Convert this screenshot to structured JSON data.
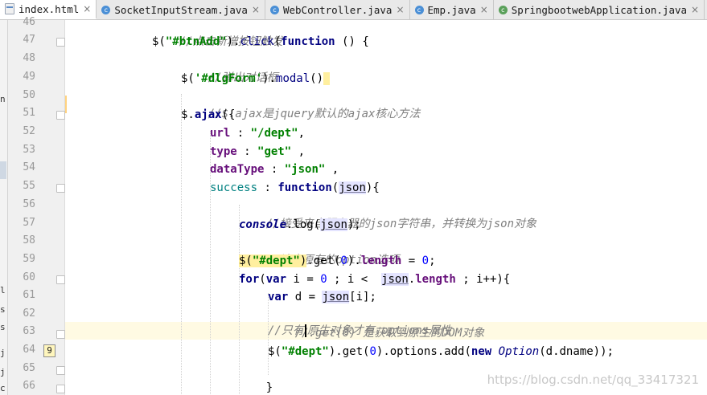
{
  "tabs": [
    {
      "label": "index.html",
      "icon": "html-file-icon",
      "active": true
    },
    {
      "label": "SocketInputStream.java",
      "icon": "class-icon",
      "active": false
    },
    {
      "label": "WebController.java",
      "icon": "class-icon",
      "active": false
    },
    {
      "label": "Emp.java",
      "icon": "class-icon",
      "active": false
    },
    {
      "label": "SpringbootwebApplication.java",
      "icon": "spring-class-icon",
      "active": false
    }
  ],
  "close_glyph": "×",
  "gutter": {
    "line_numbers": [
      "46",
      "47",
      "48",
      "49",
      "50",
      "51",
      "52",
      "53",
      "54",
      "55",
      "56",
      "57",
      "58",
      "59",
      "60",
      "61",
      "62",
      "63",
      "64",
      "65",
      "66"
    ],
    "badge_value": "9"
  },
  "left_strip": [
    "n",
    "l",
    "s",
    "s",
    "j",
    "j",
    "c"
  ],
  "code_lines": {
    "l46": "//点击新增按钮触发",
    "l47_a": "$(",
    "l47_b": "\"#btnAdd\"",
    "l47_c": ").",
    "l47_d": "click",
    "l47_e": "(",
    "l47_f": "function",
    "l47_g": " () {",
    "l48": "//弹出对话框",
    "l49_a": "$(",
    "l49_b": "'#dlgForm'",
    "l49_c": ").",
    "l49_d": "modal",
    "l49_e": "()",
    "l50": "//$.ajax是jquery默认的ajax核心方法",
    "l51_a": "$.",
    "l51_b": "ajax",
    "l51_c": "({",
    "l52_a": "url",
    "l52_b": " : ",
    "l52_c": "\"/dept\"",
    "l52_d": ",",
    "l53_a": "type",
    "l53_b": " : ",
    "l53_c": "\"get\"",
    "l53_d": " ,",
    "l54_a": "dataType",
    "l54_b": " : ",
    "l54_c": "\"json\"",
    "l54_d": " ,",
    "l55_a": "success",
    "l55_b": " : ",
    "l55_c": "function",
    "l55_d": "(",
    "l55_e": "json",
    "l55_f": "){",
    "l56": "//接受来自服务器的json字符串，并转换为json对象",
    "l57_a": "console",
    "l57_b": ".log(",
    "l57_c": "json",
    "l57_d": ");",
    "l58": "//清空原有的option选项",
    "l59_a": "$(",
    "l59_b": "\"#dept\"",
    "l59_c": ")",
    "l59_d": ".get(",
    "l59_e": "0",
    "l59_f": ").",
    "l59_g": "length",
    "l59_h": " = ",
    "l59_i": "0",
    "l59_j": ";",
    "l60_a": "for",
    "l60_b": "(",
    "l60_c": "var",
    "l60_d": " i = ",
    "l60_e": "0",
    "l60_f": " ; i <  ",
    "l60_g": "json",
    "l60_h": ".",
    "l60_i": "length",
    "l60_j": " ; i++){",
    "l61_a": "var",
    "l61_b": " d = ",
    "l61_c": "json",
    "l61_d": "[i];",
    "l62": "//.get(0) 是获取到原生的DOM对象",
    "l63_a": "//只有",
    "l63_b": "原生对象才有.options属性",
    "l64_a": "$(",
    "l64_b": "\"#dept\"",
    "l64_c": ").get(",
    "l64_d": "0",
    "l64_e": ").options.add(",
    "l64_f": "new",
    "l64_g": " ",
    "l64_h": "Option",
    "l64_i": "(d.dname));",
    "l65": "}",
    "l66": "}"
  },
  "watermark": "https://blog.csdn.net/qq_33417321"
}
